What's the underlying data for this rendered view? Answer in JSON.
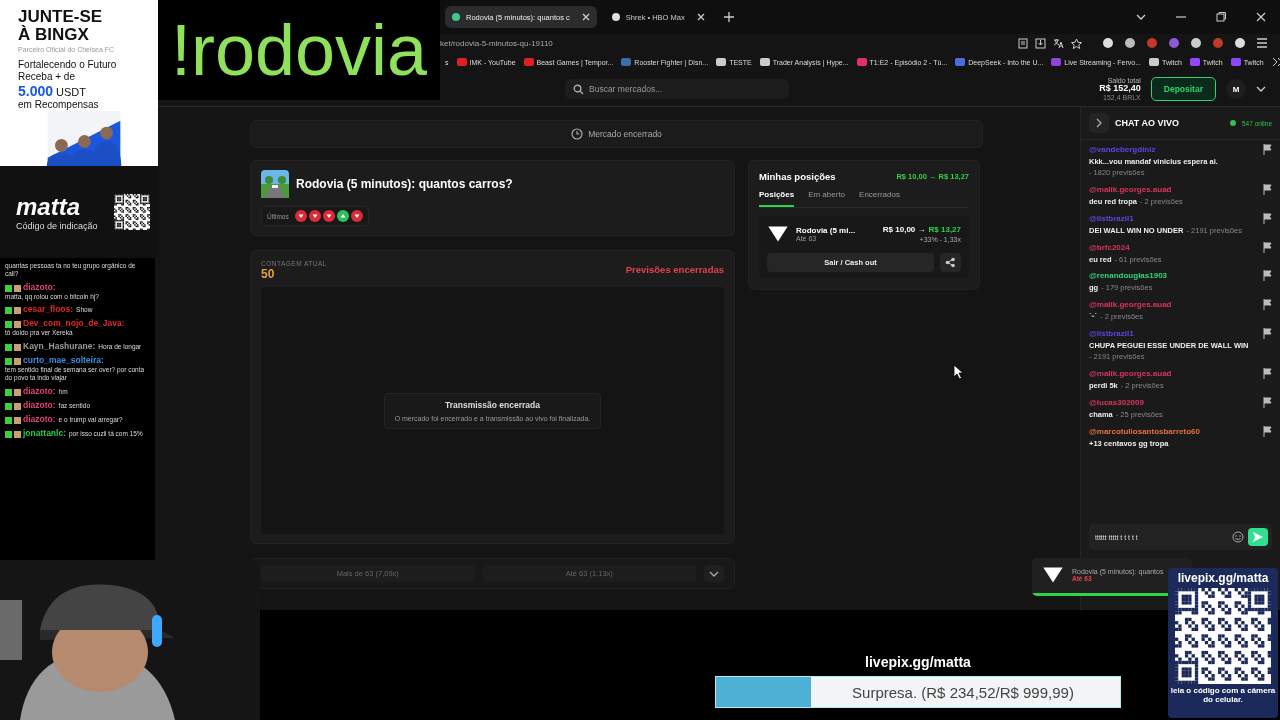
{
  "browser": {
    "tabs": [
      {
        "title": "Rodovia (5 minutos): quantos c",
        "selected": true
      },
      {
        "title": "Shrek • HBO Max",
        "selected": false
      }
    ],
    "address": "ket/rodovia-5-minutos-qu-19110",
    "bookmarks": [
      {
        "label": "s"
      },
      {
        "label": "IMK - YouTube"
      },
      {
        "label": "Beast Games | Tempor..."
      },
      {
        "label": "Rooster Fighter | Disn..."
      },
      {
        "label": "TESTE"
      },
      {
        "label": "Trader Analysis | Hype..."
      },
      {
        "label": "T1:E2 - Episódio 2 - Tú..."
      },
      {
        "label": "DeepSeek - Into the U..."
      },
      {
        "label": "Live Streaming - Fervo..."
      },
      {
        "label": "Twitch"
      },
      {
        "label": "Twitch"
      },
      {
        "label": "Twitch"
      }
    ]
  },
  "app": {
    "search_placeholder": "Buscar mercados...",
    "balance_label": "Saldo total",
    "balance": "R$ 152,40",
    "balance_sub": "152,4 BRLX",
    "deposit_button": "Depositar",
    "avatar": "M"
  },
  "market": {
    "status": "Mercado encerrado",
    "title": "Rodovia (5 minutos): quantos carros?",
    "recent_label": "Últimos",
    "recent": [
      {
        "kind": "down"
      },
      {
        "kind": "down"
      },
      {
        "kind": "down"
      },
      {
        "kind": "up"
      },
      {
        "kind": "down"
      }
    ],
    "count_label": "CONTAGEM ATUAL",
    "count": "50",
    "predictions_status": "Previsões encerradas",
    "stream_title": "Transmissão encerrada",
    "stream_message": "O mercado foi encerrado e a transmissão ao vivo foi finalizada.",
    "options": [
      "Mais de 63 (7,09x)",
      "Até 63 (1,13x)"
    ]
  },
  "positions": {
    "title": "Minhas posições",
    "total": "R$ 10,00 → R$ 13,27",
    "tabs": [
      {
        "label": "Posições",
        "selected": true
      },
      {
        "label": "Em aberto",
        "selected": false
      },
      {
        "label": "Encerrados",
        "selected": false
      }
    ],
    "item": {
      "kind": "down",
      "market": "Rodovia (5 mi...",
      "outcome": "Até 63",
      "amount": "R$ 10,00 →",
      "value": "R$ 13,27",
      "change": "+33% - 1,33x"
    },
    "cashout": "Sair / Cash out"
  },
  "chat": {
    "title": "CHAT AO VIVO",
    "online": "547 online",
    "messages": [
      {
        "user": "@vandebergdiniz",
        "color": "#5a46e0",
        "text": "Kkk...vou mandaf vinicius espera ai.",
        "meta": "- 1820 previsões"
      },
      {
        "user": "@malik.georges.auad",
        "color": "#d9345f",
        "text": "deu red tropa",
        "meta": "- 2 previsões"
      },
      {
        "user": "@listbrazil1",
        "color": "#5a46e0",
        "text": "DEI WALL WIN NO UNDER",
        "meta": "- 2191 previsões"
      },
      {
        "user": "@brfc2024",
        "color": "#d9345f",
        "text": "eu red",
        "meta": "- 61 previsões"
      },
      {
        "user": "@renandouglas1903",
        "color": "#2fd67a",
        "text": "gg",
        "meta": "- 179 previsões"
      },
      {
        "user": "@malik.georges.auad",
        "color": "#d9345f",
        "text": "˙ᵕ˙",
        "meta": "- 2 previsões"
      },
      {
        "user": "@listbrazil1",
        "color": "#5a46e0",
        "text": "CHUPA PEGUEI ESSE UNDER DE WALL WIN",
        "meta": "- 2191 previsões"
      },
      {
        "user": "@malik.georges.auad",
        "color": "#d9345f",
        "text": "perdi 5k",
        "meta": "- 2 previsões"
      },
      {
        "user": "@lucas302009",
        "color": "#d9345f",
        "text": "chama",
        "meta": "- 25 previsões"
      },
      {
        "user": "@marcotuliosantosbarreto60",
        "color": "#e8713c",
        "text": "+13 centavos gg tropa"
      }
    ],
    "input_value": "tttttt ttttt t t t t t"
  },
  "toast": {
    "kind": "down",
    "market": "Rodovia (5 minutos): quantos",
    "outcome": "Até 63"
  },
  "overlay_command": "!rodovia",
  "ad": {
    "headline": "JUNTE-SE À BINGX",
    "partner": "Parceiro Oficial do Chelsea FC",
    "line_1": "Fortalecendo o Futuro",
    "line_2": "Receba + de",
    "amount": "5.000",
    "currency": "USDT",
    "line_3": "em Recompensas",
    "code": "matta",
    "code_label": "Código de indicação"
  },
  "stream_chat": [
    {
      "text": "quantas pessoas ta no teu grupo orgânico de call?"
    },
    {
      "user": "diazoto:",
      "color": "#e0407a",
      "text": "matta, qq rolou com o bitcoin hj?"
    },
    {
      "user": "cesar_floos:",
      "color": "#e02a2a",
      "text": "Show"
    },
    {
      "user": "Dev_com_nojo_de_Java:",
      "color": "#e02a2a",
      "text": "tô doido pra ver Xereka"
    },
    {
      "user": "Kayn_Hashurane:",
      "color": "#9a9a9a",
      "text": "Hora de longar"
    },
    {
      "user": "curto_mae_solteira:",
      "color": "#3a8ee0",
      "text": "tem sentido final de semana ser over? por conta do povo ta indo viajar"
    },
    {
      "user": "diazoto:",
      "color": "#e0407a",
      "text": "hm"
    },
    {
      "user": "diazoto:",
      "color": "#e0407a",
      "text": "faz sentido"
    },
    {
      "user": "diazoto:",
      "color": "#e0407a",
      "text": "e o trump vai arregar?"
    },
    {
      "user": "jonattanlc:",
      "color": "#2ecc40",
      "text": "por isso cuzil tá com 15%"
    }
  ],
  "goal": {
    "url": "livepix.gg/matta",
    "label": "Surpresa. (R$ 234,52/R$ 999,99)",
    "level": 0.2345
  },
  "qr": {
    "url": "livepix.gg/matta",
    "caption": "leia o código com a câmera do celular."
  }
}
